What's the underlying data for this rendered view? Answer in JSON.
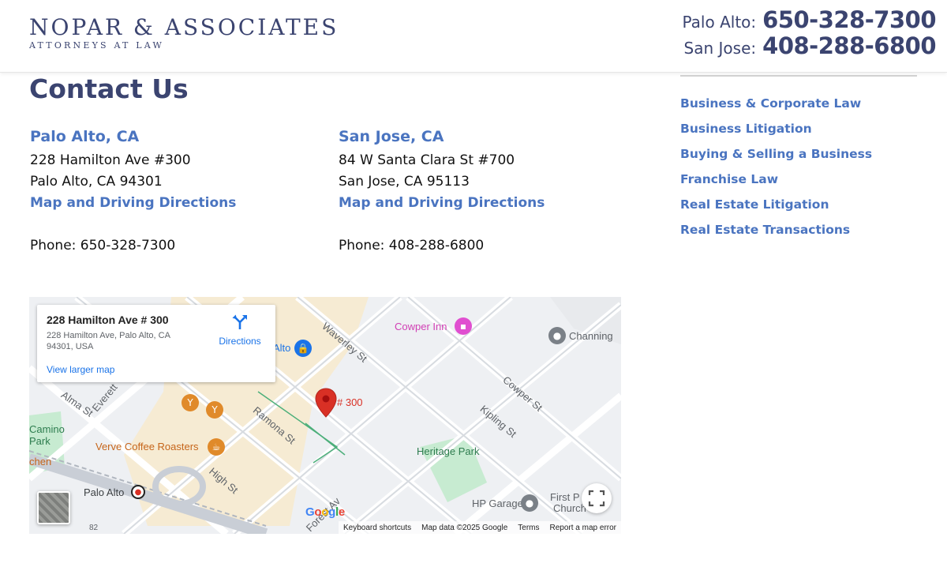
{
  "header": {
    "logo_name": "NOPAR & ASSOCIATES",
    "logo_tagline": "ATTORNEYS AT LAW",
    "phones": [
      {
        "city": "Palo Alto:",
        "number": "650-328-7300"
      },
      {
        "city": "San Jose:",
        "number": "408-288-6800"
      }
    ]
  },
  "main": {
    "title": "Contact Us",
    "offices": [
      {
        "city": "Palo Alto, CA",
        "address_line1": "228 Hamilton Ave #300",
        "address_line2": "Palo Alto, CA 94301",
        "directions_label": "Map and Driving Directions",
        "phone": "Phone: 650-328-7300"
      },
      {
        "city": "San Jose, CA",
        "address_line1": "84 W Santa Clara St #700",
        "address_line2": "San Jose, CA 95113",
        "directions_label": "Map and Driving Directions",
        "phone": "Phone: 408-288-6800"
      }
    ]
  },
  "sidebar": {
    "items": [
      {
        "label": "Business & Corporate Law"
      },
      {
        "label": "Business Litigation"
      },
      {
        "label": "Buying & Selling a Business"
      },
      {
        "label": "Franchise Law"
      },
      {
        "label": "Real Estate Litigation"
      },
      {
        "label": "Real Estate Transactions"
      }
    ]
  },
  "map": {
    "info_card": {
      "title": "228 Hamilton Ave # 300",
      "address": "228 Hamilton Ave, Palo Alto, CA 94301, USA",
      "directions_label": "Directions",
      "view_larger_label": "View larger map"
    },
    "marker_label": "# 300",
    "street_labels": {
      "waverley": "Waverley St",
      "cowper": "Cowper St",
      "kipling": "Kipling St",
      "ramona": "Ramona St",
      "alma": "Alma St",
      "everett": "Everett",
      "high": "High St",
      "forest": "Forest Av"
    },
    "place_labels": {
      "cowper_inn": "Cowper Inn",
      "channing": "Channing",
      "heritage_park": "Heritage Park",
      "verve": "Verve Coffee Roasters",
      "hp_garage": "HP Garage",
      "camino_park_1": "Camino",
      "camino_park_2": "Park",
      "palo_alto": "Palo Alto",
      "alto": "Alto",
      "first_1": "First P",
      "first_2": "Church",
      "chen": "chen",
      "route_82": "82"
    },
    "google_logo": "Google",
    "footer": {
      "shortcuts": "Keyboard shortcuts",
      "map_data": "Map data ©2025 Google",
      "terms": "Terms",
      "report": "Report a map error"
    }
  },
  "colors": {
    "brand_navy": "#3b4470",
    "link_blue": "#4a74c0",
    "map_link_blue": "#1a73e8",
    "marker_red": "#d93025"
  }
}
